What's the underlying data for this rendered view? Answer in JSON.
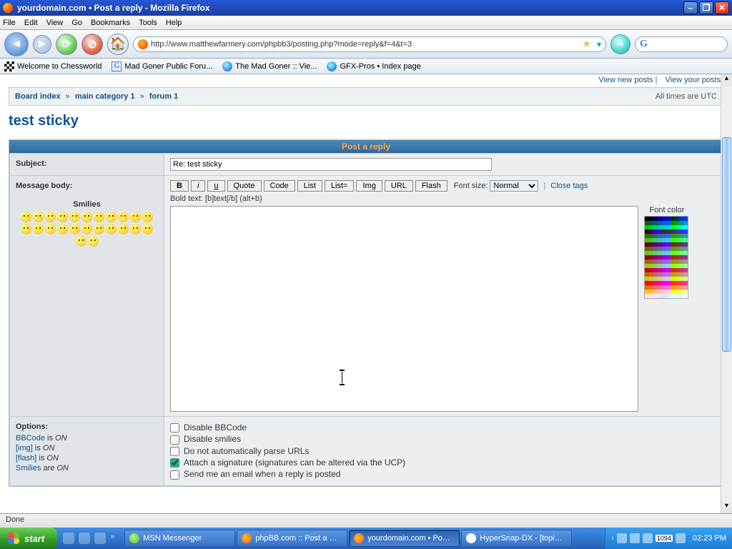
{
  "window": {
    "title": "yourdomain.com • Post a reply - Mozilla Firefox"
  },
  "menubar": [
    "File",
    "Edit",
    "View",
    "Go",
    "Bookmarks",
    "Tools",
    "Help"
  ],
  "url": "http://www.matthewfarmery.com/phpbb3/posting.php?mode=reply&f=4&t=3",
  "bookmarks": [
    "Welcome to Chessworld",
    "Mad Goner Public Foru...",
    "The Mad Goner :: Vie...",
    "GFX-Pros • Index page"
  ],
  "toplinks": {
    "newposts": "View new posts",
    "yourposts": "View your posts"
  },
  "breadcrumb": {
    "a": "Board index",
    "b": "main category 1",
    "c": "forum 1",
    "tz": "All times are UTC"
  },
  "topic_title": "test sticky",
  "panel_head": "Post a reply",
  "labels": {
    "subject": "Subject:",
    "body": "Message body:",
    "smilies": "Smilies",
    "options": "Options:",
    "fontcolor": "Font color"
  },
  "subject_value": "Re: test sticky",
  "bbcode_buttons": {
    "b": "B",
    "i": "i",
    "u": "u",
    "quote": "Quote",
    "code": "Code",
    "list": "List",
    "liste": "List=",
    "img": "Img",
    "url": "URL",
    "flash": "Flash"
  },
  "fontsize": {
    "label": "Font size:",
    "value": "Normal"
  },
  "closetags": "Close tags",
  "hint": "Bold text: [b]text[/b]  (alt+b)",
  "options": {
    "items": [
      {
        "key": "bbcode",
        "pre": "BBCode",
        "mid": " is ",
        "suf": "ON"
      },
      {
        "key": "img",
        "pre": "[img]",
        "mid": " is ",
        "suf": "ON"
      },
      {
        "key": "flash",
        "pre": "[flash]",
        "mid": " is ",
        "suf": "ON"
      },
      {
        "key": "smilies",
        "pre": "Smilies",
        "mid": " are ",
        "suf": "ON"
      }
    ],
    "checks": {
      "disable_bbcode": "Disable BBCode",
      "disable_smilies": "Disable smilies",
      "noparse": "Do not automatically parse URLs",
      "sig": "Attach a signature (signatures can be altered via the UCP)",
      "notify": "Send me an email when a reply is posted"
    }
  },
  "statusbar": "Done",
  "start": "start",
  "tasks": [
    "MSN Messenger",
    "phpBB.com :: Post a …",
    "yourdomain.com • Po…",
    "HyperSnap-DX - [topi…"
  ],
  "tray": {
    "badge": "1094",
    "clock": "02:23 PM"
  },
  "colors": [
    "#000000",
    "#000033",
    "#000066",
    "#000099",
    "#0000cc",
    "#0000ff",
    "#003300",
    "#003366",
    "#0033cc",
    "#0033ff",
    "#006600",
    "#006633",
    "#006666",
    "#006699",
    "#0066cc",
    "#0066ff",
    "#009900",
    "#009933",
    "#009966",
    "#0099cc",
    "#00cc00",
    "#00cc33",
    "#00cc66",
    "#00cc99",
    "#00cccc",
    "#00ccff",
    "#00ff00",
    "#00ff66",
    "#00ffcc",
    "#00ffff",
    "#330000",
    "#330066",
    "#3300cc",
    "#3300ff",
    "#333300",
    "#333333",
    "#333366",
    "#333399",
    "#3333cc",
    "#3333ff",
    "#336600",
    "#336633",
    "#336666",
    "#336699",
    "#3366cc",
    "#3366ff",
    "#339900",
    "#339933",
    "#339966",
    "#339999",
    "#33cc00",
    "#33cc33",
    "#33cc66",
    "#33cc99",
    "#33cccc",
    "#33ccff",
    "#33ff00",
    "#33ff33",
    "#33ff66",
    "#33ff99",
    "#660000",
    "#660033",
    "#660066",
    "#660099",
    "#6600cc",
    "#6600ff",
    "#663300",
    "#663333",
    "#663366",
    "#663399",
    "#666600",
    "#666633",
    "#666666",
    "#666699",
    "#6666cc",
    "#6666ff",
    "#669900",
    "#669933",
    "#669966",
    "#669999",
    "#66cc00",
    "#66cc33",
    "#66cc66",
    "#66cc99",
    "#66cccc",
    "#66ccff",
    "#66ff00",
    "#66ff33",
    "#66ff66",
    "#66ff99",
    "#990000",
    "#990033",
    "#990066",
    "#990099",
    "#9900cc",
    "#9900ff",
    "#993300",
    "#993333",
    "#993366",
    "#993399",
    "#996600",
    "#996633",
    "#996666",
    "#996699",
    "#9966cc",
    "#9966ff",
    "#999900",
    "#999933",
    "#999966",
    "#999999",
    "#99cc00",
    "#99cc33",
    "#99cc66",
    "#99cc99",
    "#99cccc",
    "#99ccff",
    "#99ff00",
    "#99ff33",
    "#99ff66",
    "#99ff99",
    "#cc0000",
    "#cc0033",
    "#cc0066",
    "#cc0099",
    "#cc00cc",
    "#cc00ff",
    "#cc3300",
    "#cc3333",
    "#cc3366",
    "#cc3399",
    "#cc6600",
    "#cc6633",
    "#cc6666",
    "#cc6699",
    "#cc66cc",
    "#cc66ff",
    "#cc9900",
    "#cc9933",
    "#cc9966",
    "#cc9999",
    "#cccc00",
    "#cccc33",
    "#cccc66",
    "#cccc99",
    "#cccccc",
    "#ccccff",
    "#ccff00",
    "#ccff33",
    "#ccff66",
    "#ccff99",
    "#ff0000",
    "#ff0033",
    "#ff0066",
    "#ff0099",
    "#ff00cc",
    "#ff00ff",
    "#ff3300",
    "#ff3333",
    "#ff3366",
    "#ff3399",
    "#ff6600",
    "#ff6633",
    "#ff6666",
    "#ff6699",
    "#ff66cc",
    "#ff66ff",
    "#ff9900",
    "#ff9933",
    "#ff9966",
    "#ff9999",
    "#ffcc00",
    "#ffcc33",
    "#ffcc66",
    "#ffcc99",
    "#ffcccc",
    "#ffccff",
    "#ffff00",
    "#ffff33",
    "#ffff66",
    "#ffff99",
    "#ffe0e0",
    "#ffe0f0",
    "#ffe0ff",
    "#f0e0ff",
    "#e0e0ff",
    "#e0f0ff",
    "#e0ffff",
    "#e0fff0",
    "#e0ffe0",
    "#ffffff"
  ]
}
